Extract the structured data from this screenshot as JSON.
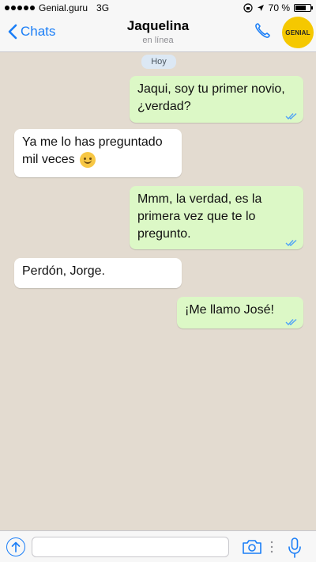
{
  "status_bar": {
    "carrier": "Genial.guru",
    "network": "3G",
    "battery_text": "70 %",
    "battery_level": 0.7
  },
  "header": {
    "back_label": "Chats",
    "contact_name": "Jaquelina",
    "contact_status": "en línea",
    "logo_text": "GENIAL"
  },
  "chat": {
    "date_label": "Hoy",
    "messages": [
      {
        "direction": "outgoing",
        "lines": [
          "Jaqui, soy tu primer novio,",
          "¿verdad?"
        ],
        "read": true
      },
      {
        "direction": "incoming",
        "lines": [
          "Ya me lo has preguntado",
          "mil veces"
        ],
        "emoji": "smiling-face"
      },
      {
        "direction": "outgoing",
        "lines": [
          "Mmm, la verdad, es la",
          "primera vez que te lo",
          "pregunto."
        ],
        "read": true
      },
      {
        "direction": "incoming",
        "lines": [
          "Perdón, Jorge."
        ]
      },
      {
        "direction": "outgoing",
        "lines": [
          "¡Me llamo José!"
        ],
        "read": true
      }
    ]
  },
  "input_bar": {
    "placeholder": ""
  },
  "colors": {
    "accent": "#1a7ef7",
    "outgoing_bubble": "#dcf8c6",
    "incoming_bubble": "#ffffff",
    "chat_background": "#e3dbd0",
    "logo": "#f5c800"
  }
}
